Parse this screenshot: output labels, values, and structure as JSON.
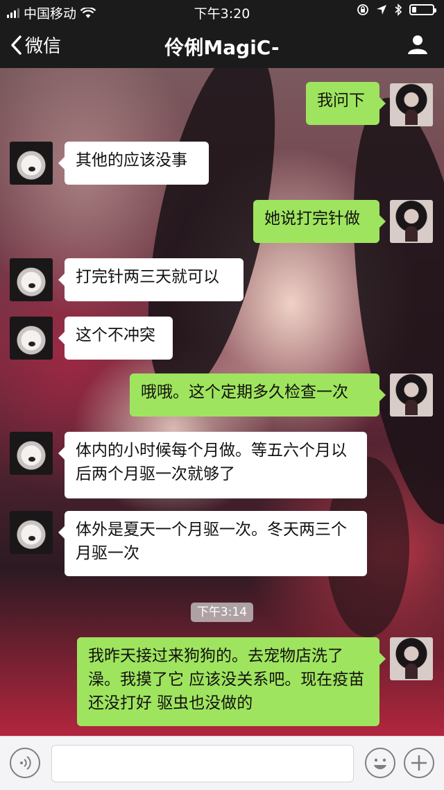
{
  "status_bar": {
    "carrier": "中国移动",
    "time": "下午3:20"
  },
  "nav": {
    "back_label": "微信",
    "title": "伶俐MagiC-",
    "contact_icon": "person-icon"
  },
  "messages": [
    {
      "side": "right",
      "text": "我问下"
    },
    {
      "side": "left",
      "text": "其他的应该没事"
    },
    {
      "side": "right",
      "text": "她说打完针做"
    },
    {
      "side": "left",
      "text": "打完针两三天就可以"
    },
    {
      "side": "left",
      "text": "这个不冲突"
    },
    {
      "side": "right",
      "text": "哦哦。这个定期多久检查一次"
    },
    {
      "side": "left",
      "text": "体内的小时候每个月做。等五六个月以后两个月驱一次就够了"
    },
    {
      "side": "left",
      "text": "体外是夏天一个月驱一次。冬天两三个月驱一次"
    },
    {
      "side": "right",
      "text": "我昨天接过来狗狗的。去宠物店洗了澡。我摸了它 应该没关系吧。现在疫苗还没打好 驱虫也没做的"
    }
  ],
  "timestamp": "下午3:14",
  "input_bar": {
    "voice_icon": "voice-icon",
    "emoji_icon": "emoji-icon",
    "add_icon": "plus-icon"
  },
  "colors": {
    "bar": "#1b1b1b",
    "sent_bubble": "#9fe45e",
    "received_bubble": "#ffffff"
  }
}
